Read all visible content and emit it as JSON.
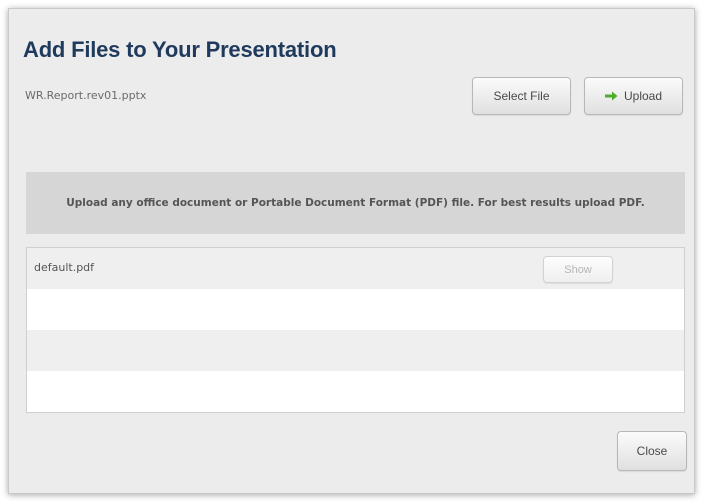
{
  "dialog": {
    "title": "Add Files to Your Presentation",
    "selected_file": "WR.Report.rev01.pptx",
    "select_file_label": "Select File",
    "upload_label": "Upload",
    "upload_icon": "arrow-right-icon",
    "upload_icon_color": "#4caf2a",
    "info_text": "Upload any office document or Portable Document Format (PDF) file.  For best results upload PDF.",
    "close_label": "Close"
  },
  "file_list": {
    "rows": [
      {
        "name": "default.pdf",
        "action_label": "Show"
      },
      {
        "name": ""
      },
      {
        "name": ""
      },
      {
        "name": ""
      }
    ]
  },
  "colors": {
    "title": "#1f3a5c",
    "dialog_background": "#ececec",
    "info_band": "#d6d6d6",
    "row_alt": "#efefef"
  }
}
